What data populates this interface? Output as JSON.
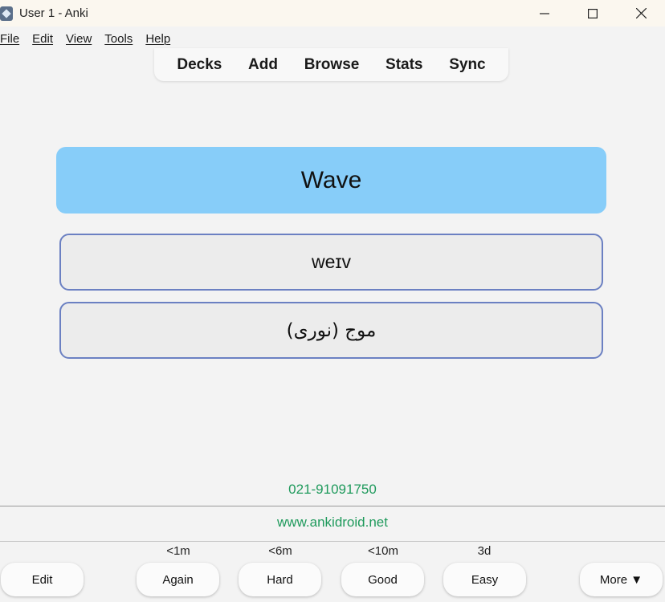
{
  "window": {
    "title": "User 1 - Anki",
    "icon": "anki-star-icon",
    "controls": [
      "minimize-icon",
      "maximize-icon",
      "close-icon"
    ]
  },
  "menu": {
    "file": "File",
    "edit": "Edit",
    "view": "View",
    "tools": "Tools",
    "help": "Help"
  },
  "toolbar": {
    "decks": "Decks",
    "add": "Add",
    "browse": "Browse",
    "stats": "Stats",
    "sync": "Sync"
  },
  "card": {
    "front": "Wave",
    "ipa": "weɪv",
    "translation": "موج (نوری)",
    "front_color": "#87cdf9",
    "box_border_color": "#6b80c2"
  },
  "footer": {
    "phone": "021-91091750",
    "website": "www.ankidroid.net",
    "text_color": "#1f9a5c"
  },
  "answer_bar": {
    "edit": "Edit",
    "again": {
      "label": "Again",
      "interval": "<1m"
    },
    "hard": {
      "label": "Hard",
      "interval": "<6m"
    },
    "good": {
      "label": "Good",
      "interval": "<10m"
    },
    "easy": {
      "label": "Easy",
      "interval": "3d"
    },
    "more": "More ▼"
  }
}
